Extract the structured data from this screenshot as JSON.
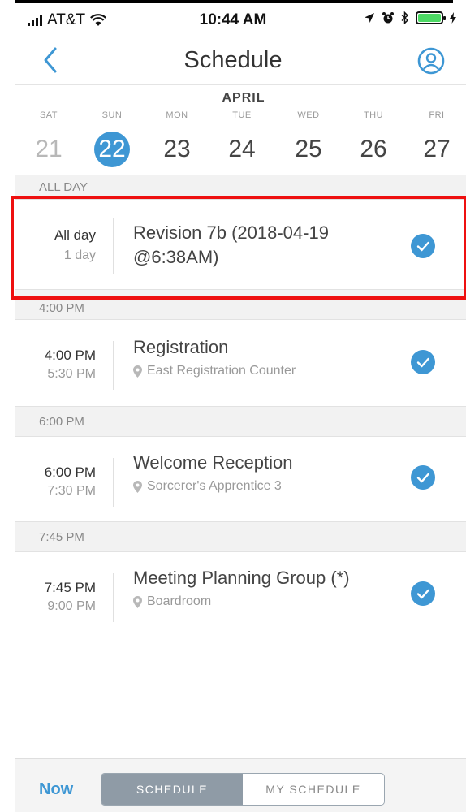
{
  "status_bar": {
    "carrier": "AT&T",
    "time": "10:44 AM"
  },
  "header": {
    "title": "Schedule",
    "back_icon": "chevron-left-icon",
    "profile_icon": "user-circle-icon",
    "accent_color": "#3e97d4"
  },
  "calendar": {
    "month": "APRIL",
    "days": [
      {
        "name": "SAT",
        "num": "21"
      },
      {
        "name": "SUN",
        "num": "22"
      },
      {
        "name": "MON",
        "num": "23"
      },
      {
        "name": "TUE",
        "num": "24"
      },
      {
        "name": "WED",
        "num": "25"
      },
      {
        "name": "THU",
        "num": "26"
      },
      {
        "name": "FRI",
        "num": "27"
      }
    ],
    "selected": "22"
  },
  "sections": {
    "all_day": "ALL DAY",
    "s1": "4:00 PM",
    "s2": "6:00 PM",
    "s3": "7:45 PM"
  },
  "events": [
    {
      "start": "All day",
      "end": "1 day",
      "title": "Revision 7b (2018-04-19 @6:38AM)",
      "location": ""
    },
    {
      "start": "4:00 PM",
      "end": "5:30 PM",
      "title": "Registration",
      "location": "East Registration Counter"
    },
    {
      "start": "6:00 PM",
      "end": "7:30 PM",
      "title": "Welcome Reception",
      "location": "Sorcerer's Apprentice 3"
    },
    {
      "start": "7:45 PM",
      "end": "9:00 PM",
      "title": "Meeting Planning Group (*)",
      "location": "Boardroom"
    }
  ],
  "tabbar": {
    "now": "Now",
    "schedule": "SCHEDULE",
    "my_schedule": "MY SCHEDULE"
  }
}
